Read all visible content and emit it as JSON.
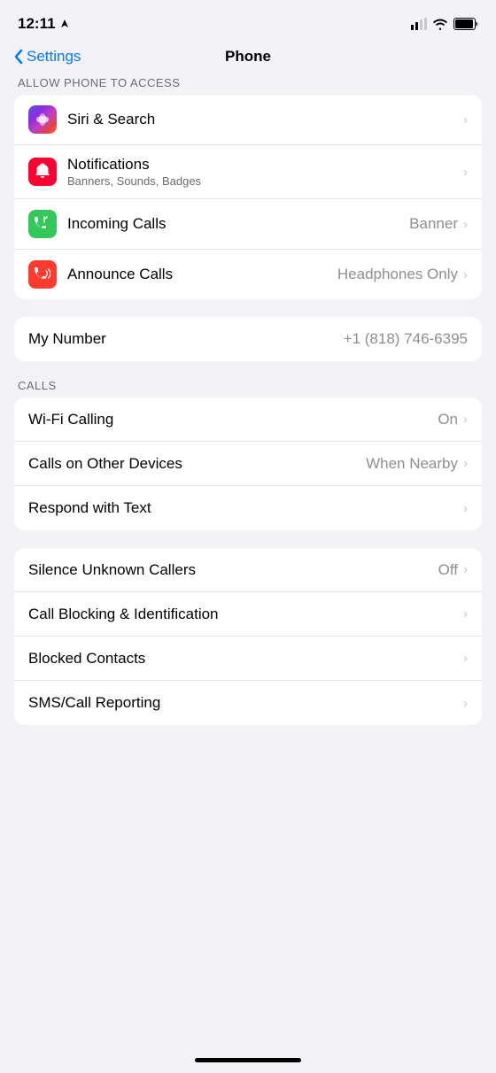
{
  "statusBar": {
    "time": "12:11",
    "locationIcon": "▲"
  },
  "nav": {
    "backLabel": "Settings",
    "title": "Phone"
  },
  "sections": {
    "allowAccess": {
      "label": "ALLOW PHONE TO ACCESS",
      "items": [
        {
          "id": "siri-search",
          "title": "Siri & Search",
          "subtitle": "",
          "rightText": "",
          "iconType": "siri",
          "hasChevron": true
        },
        {
          "id": "notifications",
          "title": "Notifications",
          "subtitle": "Banners, Sounds, Badges",
          "rightText": "",
          "iconType": "notifications",
          "hasChevron": true
        },
        {
          "id": "incoming-calls",
          "title": "Incoming Calls",
          "subtitle": "",
          "rightText": "Banner",
          "iconType": "incoming",
          "hasChevron": true
        },
        {
          "id": "announce-calls",
          "title": "Announce Calls",
          "subtitle": "",
          "rightText": "Headphones Only",
          "iconType": "announce",
          "hasChevron": true
        }
      ]
    },
    "myNumber": {
      "items": [
        {
          "id": "my-number",
          "title": "My Number",
          "subtitle": "",
          "rightText": "+1 (818) 746-6395",
          "iconType": "none",
          "hasChevron": false
        }
      ]
    },
    "calls": {
      "label": "CALLS",
      "items": [
        {
          "id": "wifi-calling",
          "title": "Wi-Fi Calling",
          "subtitle": "",
          "rightText": "On",
          "iconType": "none",
          "hasChevron": true
        },
        {
          "id": "calls-other-devices",
          "title": "Calls on Other Devices",
          "subtitle": "",
          "rightText": "When Nearby",
          "iconType": "none",
          "hasChevron": true
        },
        {
          "id": "respond-text",
          "title": "Respond with Text",
          "subtitle": "",
          "rightText": "",
          "iconType": "none",
          "hasChevron": true
        }
      ]
    },
    "blocking": {
      "items": [
        {
          "id": "silence-unknown",
          "title": "Silence Unknown Callers",
          "subtitle": "",
          "rightText": "Off",
          "iconType": "none",
          "hasChevron": true
        },
        {
          "id": "call-blocking",
          "title": "Call Blocking & Identification",
          "subtitle": "",
          "rightText": "",
          "iconType": "none",
          "hasChevron": true
        },
        {
          "id": "blocked-contacts",
          "title": "Blocked Contacts",
          "subtitle": "",
          "rightText": "",
          "iconType": "none",
          "hasChevron": true
        },
        {
          "id": "sms-reporting",
          "title": "SMS/Call Reporting",
          "subtitle": "",
          "rightText": "",
          "iconType": "none",
          "hasChevron": true
        }
      ]
    }
  }
}
